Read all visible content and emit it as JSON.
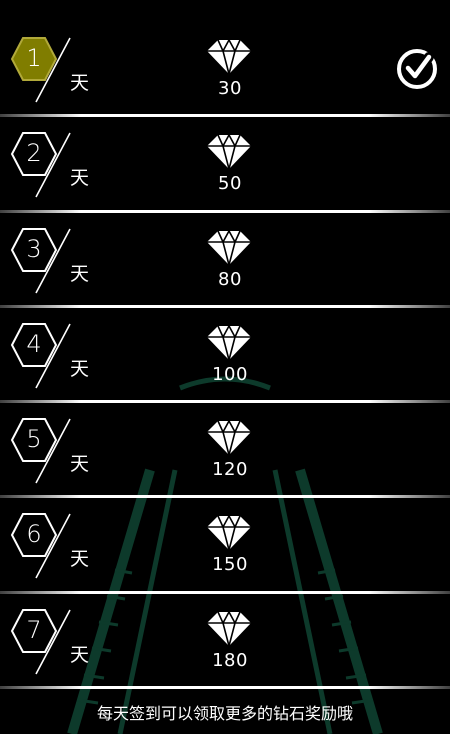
{
  "colors": {
    "background": "#000000",
    "active_hex": "#807d00",
    "active_hex_border": "#b1a93a",
    "track_green": "#0d3a2b",
    "foreground": "#ffffff"
  },
  "signin": {
    "day_unit": "天",
    "days": [
      {
        "num": "1",
        "reward": "30",
        "state": "claimed",
        "icon": "diamond-icon"
      },
      {
        "num": "2",
        "reward": "50",
        "state": "locked",
        "icon": "diamond-icon"
      },
      {
        "num": "3",
        "reward": "80",
        "state": "locked",
        "icon": "diamond-icon"
      },
      {
        "num": "4",
        "reward": "100",
        "state": "locked",
        "icon": "diamond-icon"
      },
      {
        "num": "5",
        "reward": "120",
        "state": "locked",
        "icon": "diamond-icon"
      },
      {
        "num": "6",
        "reward": "150",
        "state": "locked",
        "icon": "diamond-icon"
      },
      {
        "num": "7",
        "reward": "180",
        "state": "locked",
        "icon": "diamond-icon"
      }
    ]
  },
  "footer": {
    "text": "每天签到可以领取更多的钻石奖励哦"
  }
}
